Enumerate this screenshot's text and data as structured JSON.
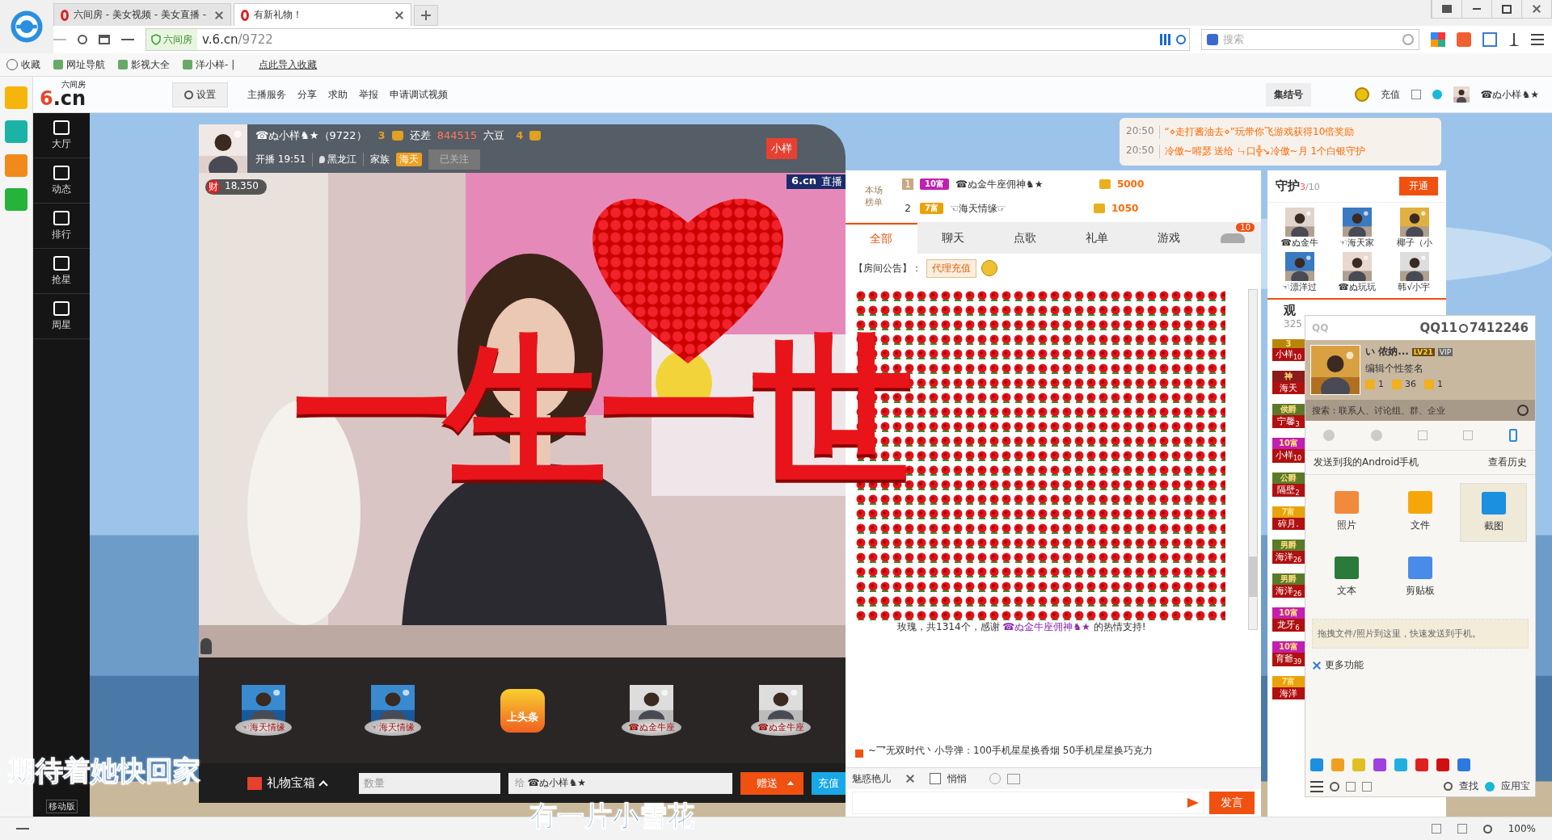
{
  "browser": {
    "tabs": [
      {
        "title": "六间房 - 美女视频 - 美女直播 -",
        "selected": false
      },
      {
        "title": "有新礼物！",
        "selected": true
      }
    ],
    "url": {
      "badge": "六间房",
      "host": "v.6.cn",
      "path": "/9722"
    },
    "search": {
      "placeholder": "搜索"
    },
    "bookmarks": [
      "收藏",
      "网址导航",
      "影视大全",
      "洋小样- |"
    ],
    "import_link": "点此导入收藏"
  },
  "site_header": {
    "logo_mark": "6",
    "logo_text": ".cn",
    "logo_sub": "六间房",
    "settings": "设置",
    "links": [
      "主播服务",
      "分享",
      "求助",
      "举报",
      "申请调试视频"
    ],
    "rally": "集结号",
    "recharge": "充值",
    "user": "☎ぬ小样♞★"
  },
  "site_nav": [
    "大厅",
    "动态",
    "排行",
    "抢星",
    "周星"
  ],
  "mobile": "移动版",
  "anchor": {
    "name": "☎ぬ小样♞★（9722）",
    "level": "3",
    "gap_label": "还差",
    "gap": "844515",
    "unit": "六豆",
    "next_level": "4",
    "start": "开播 19:51",
    "location": "黑龙江",
    "family_label": "家族",
    "family": "海天",
    "follow": "已关注",
    "flag": "小样",
    "wealth_label": "财",
    "wealth": "18,350",
    "logo": "6.cn",
    "live": "直播"
  },
  "gift_animation": {
    "text": "一生一世"
  },
  "gift_strip": [
    {
      "kind": "user",
      "name": "☜海天情缘"
    },
    {
      "kind": "user",
      "name": "☜海天情缘"
    },
    {
      "kind": "headline",
      "name": "上头条"
    },
    {
      "kind": "user",
      "name": "☎ぬ金牛座"
    },
    {
      "kind": "user",
      "name": "☎ぬ金牛座"
    }
  ],
  "gift_bar": {
    "gift_box": "礼物宝箱",
    "quantity_placeholder": "数量",
    "to_label": "给",
    "to": "☎ぬ小样♞★",
    "send": "赠送",
    "recharge": "充值"
  },
  "ranking": {
    "label": "本场榜单",
    "rows": [
      {
        "rank": "1",
        "badge": "10富",
        "color": "#c21fb0",
        "name": "☎ぬ金牛座佣神♞★",
        "amount": "5000"
      },
      {
        "rank": "2",
        "badge": "7富",
        "color": "#e8a20c",
        "name": "☜海天情缘☞",
        "amount": "1050"
      }
    ]
  },
  "chat_tabs": [
    {
      "label": "全部",
      "selected": true
    },
    {
      "label": "聊天",
      "selected": false
    },
    {
      "label": "点歌",
      "selected": false
    },
    {
      "label": "礼单",
      "selected": false
    },
    {
      "label": "游戏",
      "selected": false
    }
  ],
  "car_count": "10",
  "announcement": {
    "label": "【房间公告】：",
    "tag": "代理充值"
  },
  "gift_message": {
    "prefix": "玫瑰，共1314个，感谢",
    "name": "☎ぬ金牛座佣神♞★",
    "suffix": "的热情支持!"
  },
  "system_message": {
    "sender": "~乛无双时代丶小导弹：",
    "text": "100手机星星换香烟 50手机星星换巧克力"
  },
  "chat_input": {
    "recipient": "魅惑艳儿",
    "private_label": "悄悄",
    "private": false,
    "send": "发言"
  },
  "notifications": [
    {
      "time": "20:50",
      "text": "“⋄走打酱油去⋄”玩带你飞游戏获得10倍奖励"
    },
    {
      "time": "20:50",
      "text": "冷傲~嘚瑟 送给 ㄣ口╬↘冷傲~月 1个白银守护"
    }
  ],
  "guard": {
    "title": "守护",
    "count": "3",
    "total": "/10",
    "open": "开通",
    "members": [
      "☎ぬ金牛",
      "☜海天家",
      "椰子（小",
      "☜漂洋过",
      "☎ぬ玩玩",
      "韩√小宇"
    ]
  },
  "audience": {
    "title": "观",
    "count": "325",
    "members": [
      {
        "badge": "3",
        "color": "#b8860b",
        "name": "小样",
        "sub": "10"
      },
      {
        "badge": "神",
        "color": "#8b1a1a",
        "name": "海天"
      },
      {
        "badge": "侯爵",
        "color": "#5a7a2a",
        "name": "宁馨",
        "sub": "3"
      },
      {
        "badge": "10富",
        "color": "#c21fb0",
        "name": "小样",
        "sub": "10"
      },
      {
        "badge": "公爵",
        "color": "#5a7a2a",
        "name": "隔壁",
        "sub": "2"
      },
      {
        "badge": "7富",
        "color": "#e8a20c",
        "name": "碎月."
      },
      {
        "badge": "男爵",
        "color": "#5a7a2a",
        "name": "海洋",
        "sub": "26"
      },
      {
        "badge": "男爵",
        "color": "#5a7a2a",
        "name": "海洋",
        "sub": "26"
      },
      {
        "badge": "10富",
        "color": "#c21fb0",
        "name": "龙牙",
        "sub": "6"
      },
      {
        "badge": "10富",
        "color": "#c21fb0",
        "name": "育爺",
        "sub": "39"
      },
      {
        "badge": "7富",
        "color": "#e8a20c",
        "name": "海洋"
      }
    ]
  },
  "qq": {
    "title": "QQ",
    "number": "QQ11",
    "number_rest": "7412246",
    "nickname": "い 侬妠...",
    "level": "LV21",
    "vip": "VIP",
    "signature": "编辑个性签名",
    "counts": [
      "1",
      "36",
      "1"
    ],
    "search_placeholder": "搜索：联系人、讨论组、群、企业",
    "send_to": "发送到我的Android手机",
    "history": "查看历史",
    "items": [
      {
        "label": "照片",
        "selected": false
      },
      {
        "kind": "file",
        "label": "文件",
        "selected": false
      },
      {
        "kind": "screenshot",
        "label": "截图",
        "selected": true
      },
      {
        "kind": "text",
        "label": "文本",
        "selected": false
      },
      {
        "kind": "clipboard",
        "label": "剪贴板",
        "selected": false
      }
    ],
    "drop_hint": "拖拽文件/照片到这里，快速发送到手机。",
    "more": "更多功能",
    "find": "查找",
    "app_store": "应用宝"
  },
  "lyrics": [
    "期待着她快回家",
    "有一片小雪花"
  ],
  "status_bar": {
    "zoom": "100%"
  }
}
